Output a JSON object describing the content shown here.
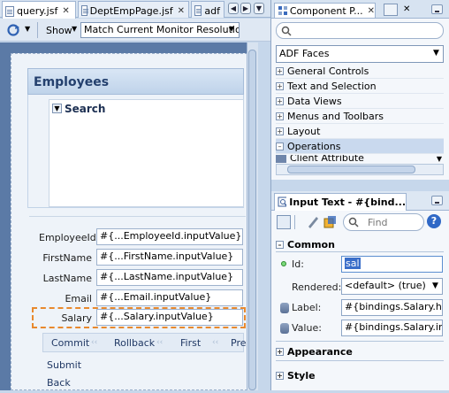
{
  "editor": {
    "tabs": [
      {
        "label": "query.jsf",
        "active": true
      },
      {
        "label": "DeptEmpPage.jsf",
        "active": false
      },
      {
        "label": "adf",
        "active": false
      }
    ],
    "toolbar": {
      "show_label": "Show",
      "show_value": "Match Current Monitor Resolution"
    }
  },
  "form": {
    "panel_title": "Employees",
    "search_label": "Search",
    "fields": [
      {
        "label": "EmployeeId",
        "value": "#{...EmployeeId.inputValue}"
      },
      {
        "label": "FirstName",
        "value": "#{...FirstName.inputValue}"
      },
      {
        "label": "LastName",
        "value": "#{...LastName.inputValue}"
      },
      {
        "label": "Email",
        "value": "#{...Email.inputValue}"
      },
      {
        "label": "Salary",
        "value": "#{...Salary.inputValue}"
      }
    ],
    "buttons": {
      "commit": "Commit",
      "rollback": "Rollback",
      "first": "First",
      "prev": "Pre",
      "submit": "Submit",
      "back": "Back"
    }
  },
  "palette": {
    "title": "Component P...",
    "library": "ADF Faces",
    "categories": [
      "General Controls",
      "Text and Selection",
      "Data Views",
      "Menus and Toolbars",
      "Layout",
      "Operations",
      "Client Attribute"
    ],
    "selected_category": "Operations"
  },
  "inspector": {
    "title": "Input Text - #{bind...",
    "find_placeholder": "Find",
    "sections": {
      "common": "Common",
      "appearance": "Appearance",
      "style": "Style"
    },
    "props": {
      "id_label": "Id:",
      "id_value": "sal",
      "rendered_label": "Rendered:",
      "rendered_value": "<default> (true)",
      "label_label": "Label:",
      "label_value": "#{bindings.Salary.hi...",
      "value_label": "Value:",
      "value_value": "#{bindings.Salary.in..."
    }
  },
  "colors": {
    "accent": "#5b7aa6",
    "selection": "#3a6ec9",
    "highlight_border": "#e8892e"
  }
}
